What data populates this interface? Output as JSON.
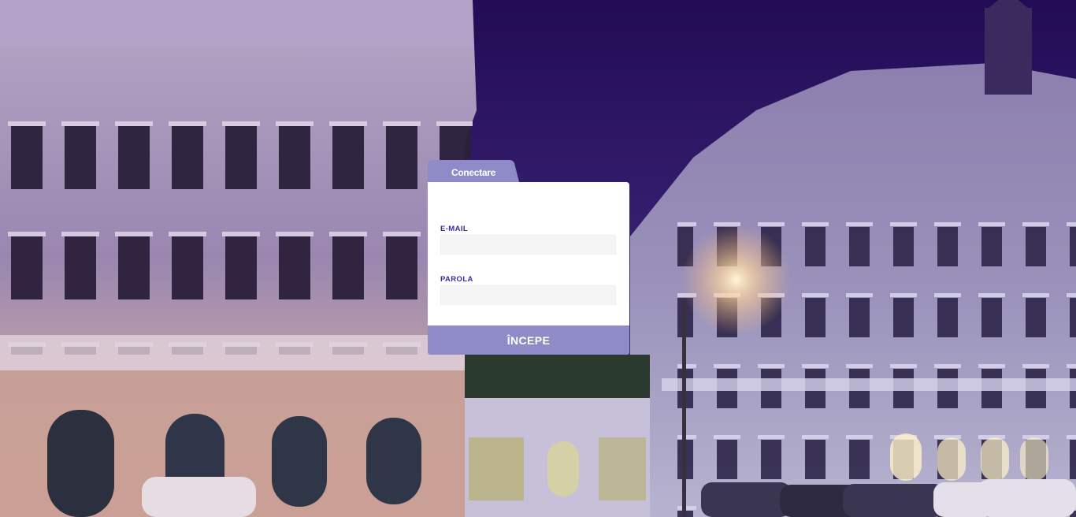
{
  "login": {
    "tab_label": "Conectare",
    "email_label": "E-MAIL",
    "email_value": "",
    "email_placeholder": "",
    "password_label": "PAROLA",
    "password_value": "",
    "password_placeholder": "",
    "submit_label": "ÎNCEPE"
  },
  "colors": {
    "accent": "#8f8ac8",
    "label": "#3d2aa0",
    "input_bg": "#f5f5f5",
    "panel_bg": "#ffffff"
  },
  "background": {
    "description_icon": "city-night-photo"
  }
}
